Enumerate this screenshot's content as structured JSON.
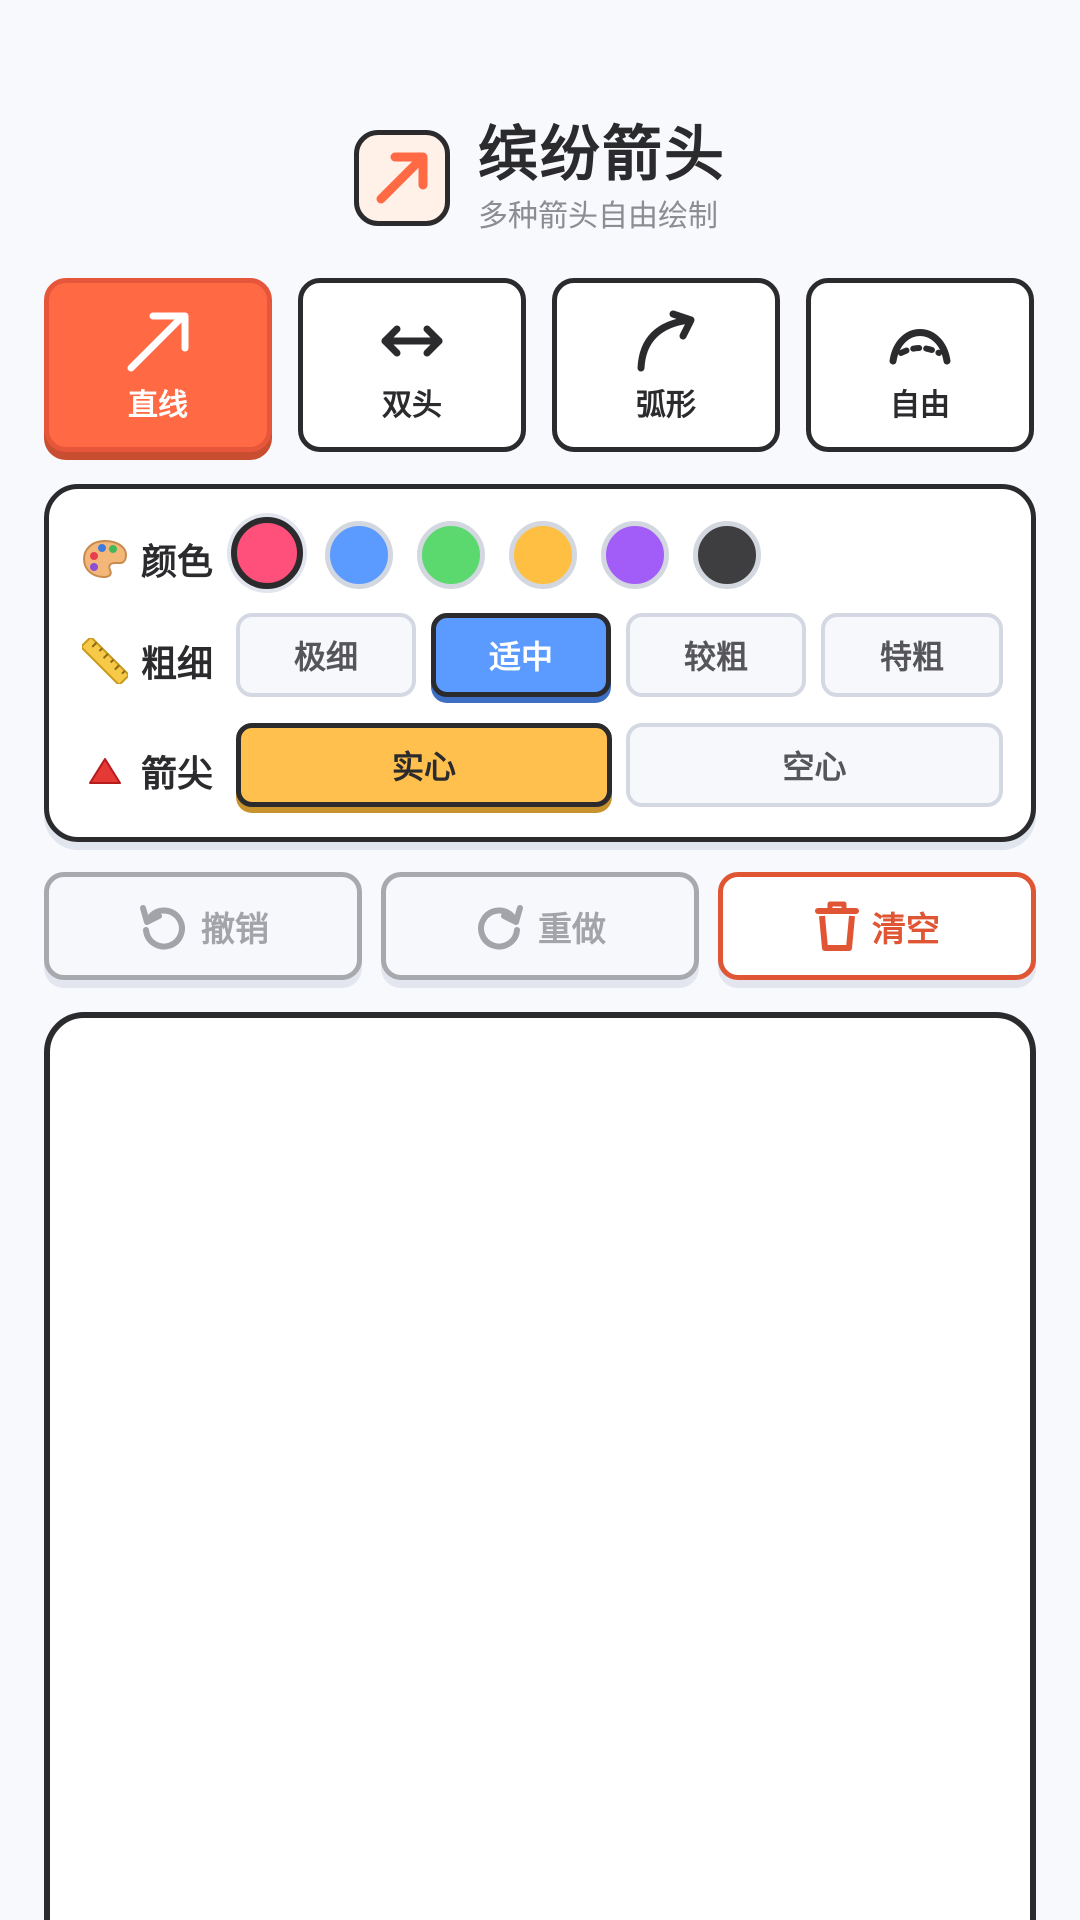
{
  "header": {
    "title": "缤纷箭头",
    "subtitle": "多种箭头自由绘制",
    "logo_icon": "diagonal-arrow-icon"
  },
  "tools": [
    {
      "label": "直线",
      "icon": "straight-arrow-icon",
      "active": true
    },
    {
      "label": "双头",
      "icon": "double-arrow-icon",
      "active": false
    },
    {
      "label": "弧形",
      "icon": "curved-arrow-icon",
      "active": false
    },
    {
      "label": "自由",
      "icon": "freehand-arrow-icon",
      "active": false
    }
  ],
  "panel": {
    "color": {
      "label": "颜色",
      "icon": "palette-icon",
      "swatches": [
        "#ff4f7b",
        "#5b9bff",
        "#5bd96e",
        "#ffbf42",
        "#a25cf7",
        "#3e3e40"
      ],
      "selected_index": 0
    },
    "thickness": {
      "label": "粗细",
      "icon": "ruler-icon",
      "options": [
        "极细",
        "适中",
        "较粗",
        "特粗"
      ],
      "selected_index": 1
    },
    "head": {
      "label": "箭尖",
      "icon": "triangle-icon",
      "options": [
        "实心",
        "空心"
      ],
      "selected_index": 0
    }
  },
  "actions": {
    "undo": {
      "label": "撤销",
      "icon": "undo-icon",
      "enabled": false
    },
    "redo": {
      "label": "重做",
      "icon": "redo-icon",
      "enabled": false
    },
    "clear": {
      "label": "清空",
      "icon": "trash-icon",
      "enabled": true
    }
  },
  "colors": {
    "accent": "#ff6a45",
    "outline": "#2b2b2e",
    "thickness_selected": "#5b9bff",
    "head_selected": "#ffc04e",
    "danger": "#e05534"
  }
}
